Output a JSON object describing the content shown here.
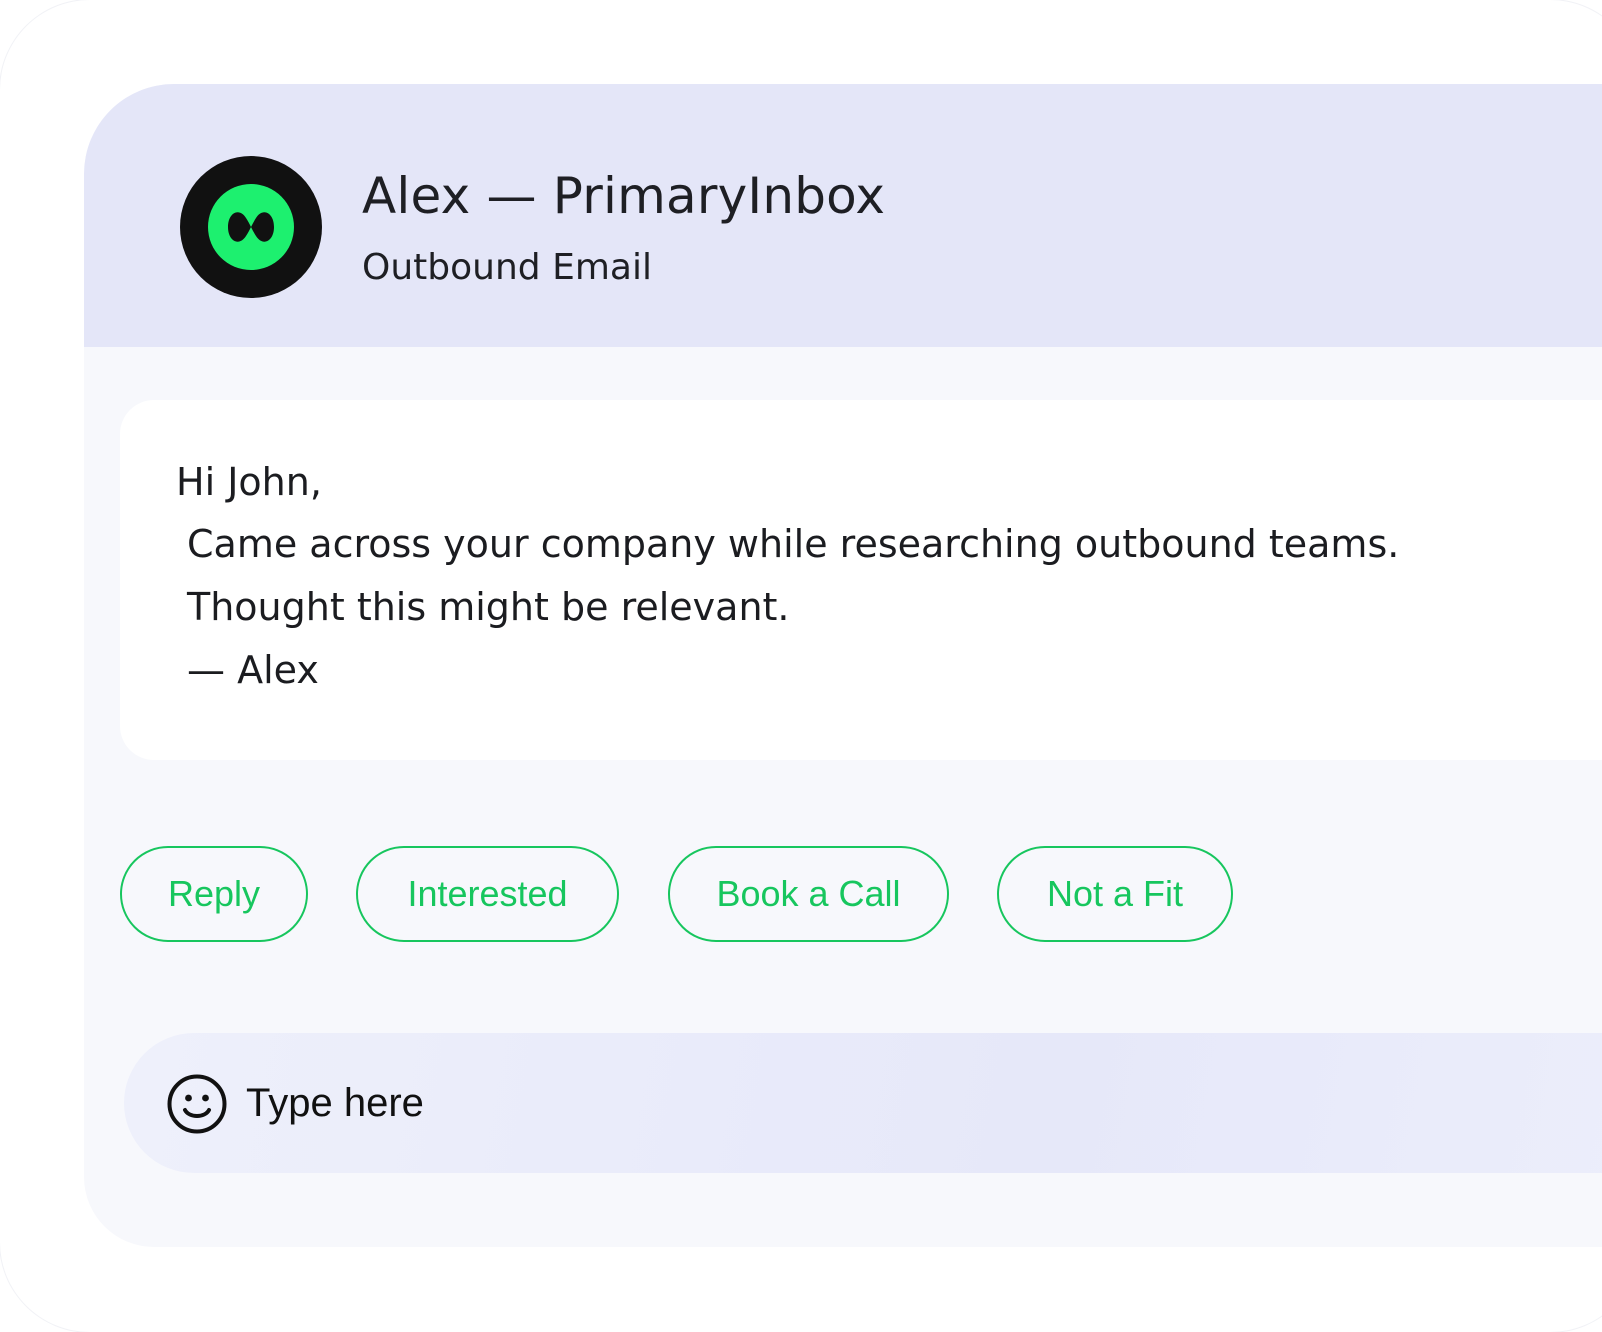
{
  "header": {
    "title": "Alex — PrimaryInbox",
    "subtitle": "Outbound Email",
    "avatar_icon": "logo-icon"
  },
  "message": {
    "lines": [
      "Hi John,",
      "Came across your company while researching outbound teams.",
      "Thought this might be relevant.",
      "— Alex"
    ]
  },
  "quick_replies": [
    {
      "label": "Reply"
    },
    {
      "label": "Interested"
    },
    {
      "label": "Book a Call"
    },
    {
      "label": "Not a Fit"
    }
  ],
  "composer": {
    "placeholder": "Type here",
    "icon": "smiley-icon"
  },
  "colors": {
    "accent": "#17C65E",
    "logo_green": "#1DF06F",
    "header_bg": "#E4E6F8",
    "card_bg": "#F7F8FC"
  }
}
